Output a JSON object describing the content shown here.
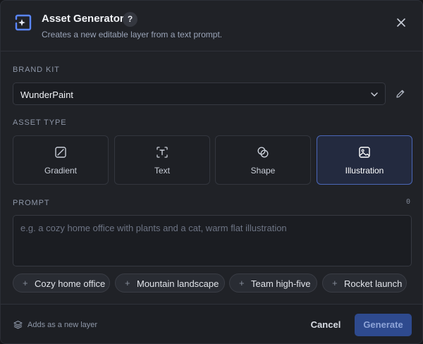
{
  "header": {
    "title": "Asset Generator",
    "help": "?",
    "subtitle": "Creates a new editable layer from a text prompt."
  },
  "brand_kit": {
    "label": "BRAND KIT",
    "value": "WunderPaint"
  },
  "asset_type": {
    "label": "ASSET TYPE",
    "options": [
      {
        "label": "Gradient",
        "icon": "gradient-icon"
      },
      {
        "label": "Text",
        "icon": "text-icon"
      },
      {
        "label": "Shape",
        "icon": "shape-icon"
      },
      {
        "label": "Illustration",
        "icon": "image-icon",
        "selected": true
      }
    ]
  },
  "prompt": {
    "label": "PROMPT",
    "counter": "0",
    "placeholder": "e.g. a cozy home office with plants and a cat, warm flat illustration",
    "value": ""
  },
  "suggestions": [
    {
      "label": "Cozy home office"
    },
    {
      "label": "Mountain landscape"
    },
    {
      "label": "Team high-five"
    },
    {
      "label": "Rocket launch"
    }
  ],
  "footer": {
    "note": "Adds as a new layer",
    "cancel": "Cancel",
    "generate": "Generate"
  },
  "colors": {
    "accent": "#4b67b8",
    "primary_button": "#2e4a8e",
    "background": "#202227"
  }
}
